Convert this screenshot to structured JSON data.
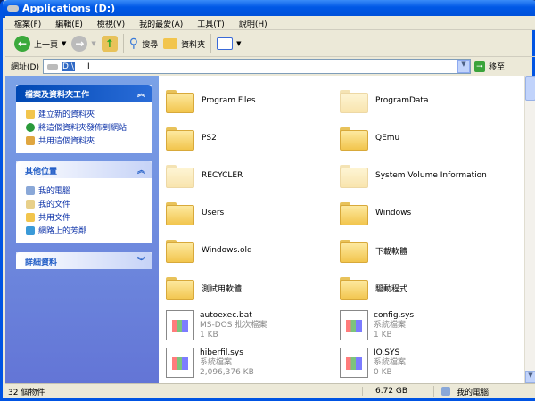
{
  "window": {
    "title": "Applications (D:)"
  },
  "menu": [
    "檔案(F)",
    "編輯(E)",
    "檢視(V)",
    "我的最愛(A)",
    "工具(T)",
    "說明(H)"
  ],
  "toolbar": {
    "back": "上一頁",
    "search": "搜尋",
    "folders": "資料夾"
  },
  "address": {
    "label": "網址(D)",
    "value": "D:\\",
    "go": "移至"
  },
  "sidebar": {
    "tasks": {
      "title": "檔案及資料夾工作",
      "items": [
        "建立新的資料夾",
        "將這個資料夾發佈到網站",
        "共用這個資料夾"
      ]
    },
    "places": {
      "title": "其他位置",
      "items": [
        "我的電腦",
        "我的文件",
        "共用文件",
        "網路上的芳鄰"
      ]
    },
    "details": {
      "title": "詳細資料"
    }
  },
  "items": [
    {
      "name": "Program Files",
      "type": "folder"
    },
    {
      "name": "ProgramData",
      "type": "folder",
      "hidden": true
    },
    {
      "name": "PS2",
      "type": "folder"
    },
    {
      "name": "QEmu",
      "type": "folder"
    },
    {
      "name": "RECYCLER",
      "type": "folder",
      "hidden": true
    },
    {
      "name": "System Volume Information",
      "type": "folder",
      "hidden": true
    },
    {
      "name": "Users",
      "type": "folder"
    },
    {
      "name": "Windows",
      "type": "folder"
    },
    {
      "name": "Windows.old",
      "type": "folder"
    },
    {
      "name": "下載軟體",
      "type": "folder"
    },
    {
      "name": "測試用軟體",
      "type": "folder"
    },
    {
      "name": "驅動程式",
      "type": "folder"
    },
    {
      "name": "autoexec.bat",
      "type": "file",
      "kind": "MS-DOS 批次檔案",
      "size": "1 KB"
    },
    {
      "name": "config.sys",
      "type": "file",
      "kind": "系統檔案",
      "size": "1 KB"
    },
    {
      "name": "hiberfil.sys",
      "type": "file",
      "kind": "系統檔案",
      "size": "2,096,376 KB"
    },
    {
      "name": "IO.SYS",
      "type": "file",
      "kind": "系統檔案",
      "size": "0 KB"
    }
  ],
  "status": {
    "count": "32 個物件",
    "size": "6.72 GB",
    "location": "我的電腦"
  }
}
